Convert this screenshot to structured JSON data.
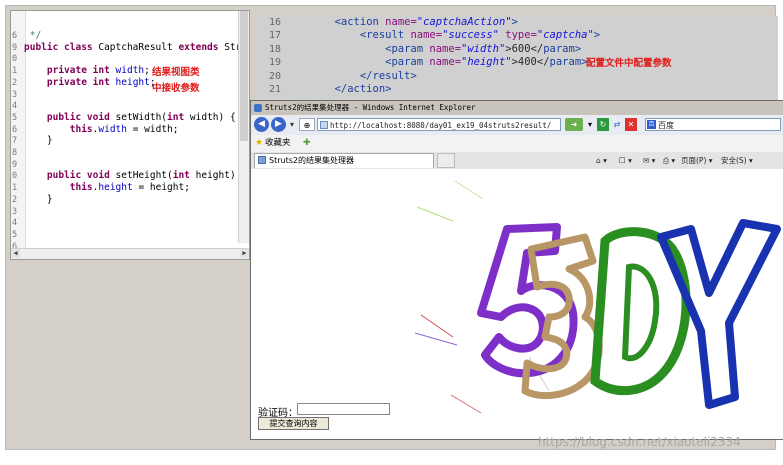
{
  "java_editor": {
    "lines": [
      {
        "n": "6",
        "segments": [
          {
            "t": " */",
            "c": "cm"
          }
        ]
      },
      {
        "n": "9",
        "segments": [
          {
            "t": "public class ",
            "c": "kw"
          },
          {
            "t": "CaptchaResult ",
            "c": ""
          },
          {
            "t": "extends ",
            "c": "kw"
          },
          {
            "t": "Strut",
            "c": ""
          }
        ]
      },
      {
        "n": "0",
        "segments": []
      },
      {
        "n": "1",
        "segments": [
          {
            "t": "    ",
            "c": ""
          },
          {
            "t": "private int ",
            "c": "kw"
          },
          {
            "t": "width",
            "c": "fld"
          },
          {
            "t": ";",
            "c": ""
          }
        ]
      },
      {
        "n": "2",
        "segments": [
          {
            "t": "    ",
            "c": ""
          },
          {
            "t": "private int ",
            "c": "kw"
          },
          {
            "t": "height",
            "c": "fld"
          },
          {
            "t": ";",
            "c": ""
          }
        ]
      },
      {
        "n": "3",
        "segments": []
      },
      {
        "n": "4",
        "segments": []
      },
      {
        "n": "5",
        "segments": [
          {
            "t": "    ",
            "c": ""
          },
          {
            "t": "public void ",
            "c": "kw"
          },
          {
            "t": "setWidth(",
            "c": ""
          },
          {
            "t": "int ",
            "c": "kw"
          },
          {
            "t": "width) {",
            "c": ""
          }
        ]
      },
      {
        "n": "6",
        "segments": [
          {
            "t": "        ",
            "c": ""
          },
          {
            "t": "this",
            "c": "kw"
          },
          {
            "t": ".",
            "c": ""
          },
          {
            "t": "width",
            "c": "fld"
          },
          {
            "t": " = width;",
            "c": ""
          }
        ]
      },
      {
        "n": "7",
        "segments": [
          {
            "t": "    }",
            "c": ""
          }
        ]
      },
      {
        "n": "8",
        "segments": []
      },
      {
        "n": "9",
        "segments": []
      },
      {
        "n": "0",
        "segments": [
          {
            "t": "    ",
            "c": ""
          },
          {
            "t": "public void ",
            "c": "kw"
          },
          {
            "t": "setHeight(",
            "c": ""
          },
          {
            "t": "int ",
            "c": "kw"
          },
          {
            "t": "height) {",
            "c": ""
          }
        ]
      },
      {
        "n": "1",
        "segments": [
          {
            "t": "        ",
            "c": ""
          },
          {
            "t": "this",
            "c": "kw"
          },
          {
            "t": ".",
            "c": ""
          },
          {
            "t": "height",
            "c": "fld"
          },
          {
            "t": " = height;",
            "c": ""
          }
        ]
      },
      {
        "n": "2",
        "segments": [
          {
            "t": "    }",
            "c": ""
          }
        ]
      },
      {
        "n": "3",
        "segments": []
      },
      {
        "n": "4",
        "segments": []
      },
      {
        "n": "5",
        "segments": []
      },
      {
        "n": "6",
        "segments": []
      },
      {
        "n": "7",
        "segments": []
      }
    ]
  },
  "notes": {
    "java_note_line1": "结果视图类",
    "java_note_line2": "中接收参数",
    "xml_note": "配置文件中配置参数"
  },
  "xml_editor": {
    "lines": [
      {
        "n": "16",
        "segments": [
          {
            "t": "        <",
            "c": "tag"
          },
          {
            "t": "action ",
            "c": "tag"
          },
          {
            "t": "name=",
            "c": "attr"
          },
          {
            "t": "\"captchaAction\"",
            "c": "sv"
          },
          {
            "t": ">",
            "c": "tag"
          }
        ]
      },
      {
        "n": "17",
        "segments": [
          {
            "t": "            <",
            "c": "tag"
          },
          {
            "t": "result ",
            "c": "tag"
          },
          {
            "t": "name=",
            "c": "attr"
          },
          {
            "t": "\"success\" ",
            "c": "sv"
          },
          {
            "t": "type=",
            "c": "attr"
          },
          {
            "t": "\"captcha\"",
            "c": "sv"
          },
          {
            "t": ">",
            "c": "tag"
          }
        ]
      },
      {
        "n": "18",
        "segments": [
          {
            "t": "                <",
            "c": "tag"
          },
          {
            "t": "param ",
            "c": "tag"
          },
          {
            "t": "name=",
            "c": "attr"
          },
          {
            "t": "\"width\"",
            "c": "sv"
          },
          {
            "t": ">600</",
            "c": ""
          },
          {
            "t": "param",
            "c": "tag"
          },
          {
            "t": ">",
            "c": "tag"
          }
        ]
      },
      {
        "n": "19",
        "segments": [
          {
            "t": "                <",
            "c": "tag"
          },
          {
            "t": "param ",
            "c": "tag"
          },
          {
            "t": "name=",
            "c": "attr"
          },
          {
            "t": "\"height\"",
            "c": "sv"
          },
          {
            "t": ">400</",
            "c": ""
          },
          {
            "t": "param",
            "c": "tag"
          },
          {
            "t": ">",
            "c": "tag"
          }
        ]
      },
      {
        "n": "20",
        "segments": [
          {
            "t": "            </",
            "c": "tag"
          },
          {
            "t": "result",
            "c": "tag"
          },
          {
            "t": ">",
            "c": "tag"
          }
        ]
      },
      {
        "n": "21",
        "segments": [
          {
            "t": "        </",
            "c": "tag"
          },
          {
            "t": "action",
            "c": "tag"
          },
          {
            "t": ">",
            "c": "tag"
          }
        ]
      }
    ]
  },
  "ie": {
    "title": "Struts2的结果集处理器 - Windows Internet Explorer",
    "address": "http://localhost:8080/day01_ex19_04struts2result/",
    "search_text": "百度",
    "favorites": "收藏夹",
    "tab_title": "Struts2的结果集处理器",
    "cmd_page": "页面(P) ▾",
    "cmd_safety": "安全(S) ▾",
    "back_icon": "back-arrow-icon",
    "forward_icon": "forward-arrow-icon"
  },
  "page": {
    "captcha_label": "验证码：",
    "captcha_value": "",
    "submit_label": "提交查询内容",
    "captcha_colors": {
      "five": "#7e2fc8",
      "three": "#b89666",
      "d": "#2a8f20",
      "y": "#1832b0"
    }
  },
  "watermark": "https://blog.csdn.net/xiaoteli2334"
}
